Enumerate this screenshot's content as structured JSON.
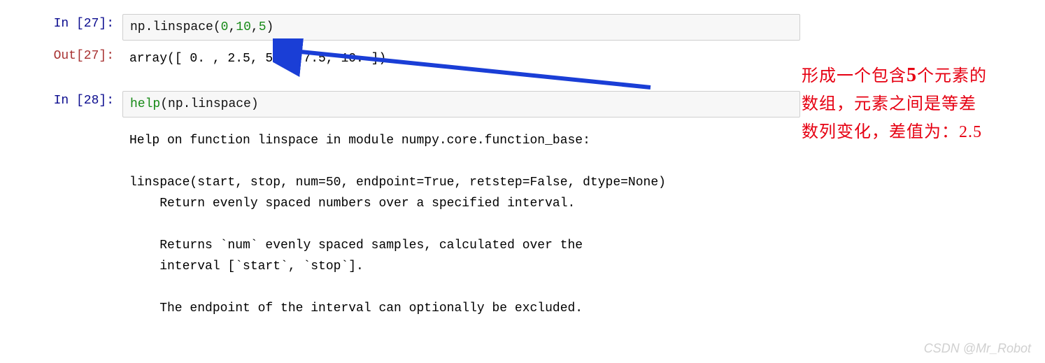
{
  "cells": {
    "in27": {
      "prompt": "In  [27]:",
      "np": "np.",
      "fn": "linspace",
      "open": "(",
      "arg1": "0",
      "comma1": ",",
      "arg2": "10",
      "comma2": ",",
      "arg3": "5",
      "close": ")"
    },
    "out27": {
      "prompt": "Out[27]:",
      "text": "array([  0. ,   2.5,   5. ,   7.5,  10. ])"
    },
    "in28": {
      "prompt": "In  [28]:",
      "help": "help",
      "open": "(",
      "np": "np.",
      "fn": "linspace",
      "close": ")"
    }
  },
  "help_output": "Help on function linspace in module numpy.core.function_base:\n\nlinspace(start, stop, num=50, endpoint=True, retstep=False, dtype=None)\n    Return evenly spaced numbers over a specified interval.\n\n    Returns `num` evenly spaced samples, calculated over the\n    interval [`start`, `stop`].\n\n    The endpoint of the interval can optionally be excluded.",
  "annotation": {
    "line1a": "形成一个包含",
    "line1b": "5",
    "line1c": "个元素的",
    "line2": "数组，元素之间是等差",
    "line3": "数列变化，差值为：2.5"
  },
  "watermark": "CSDN @Mr_Robot"
}
